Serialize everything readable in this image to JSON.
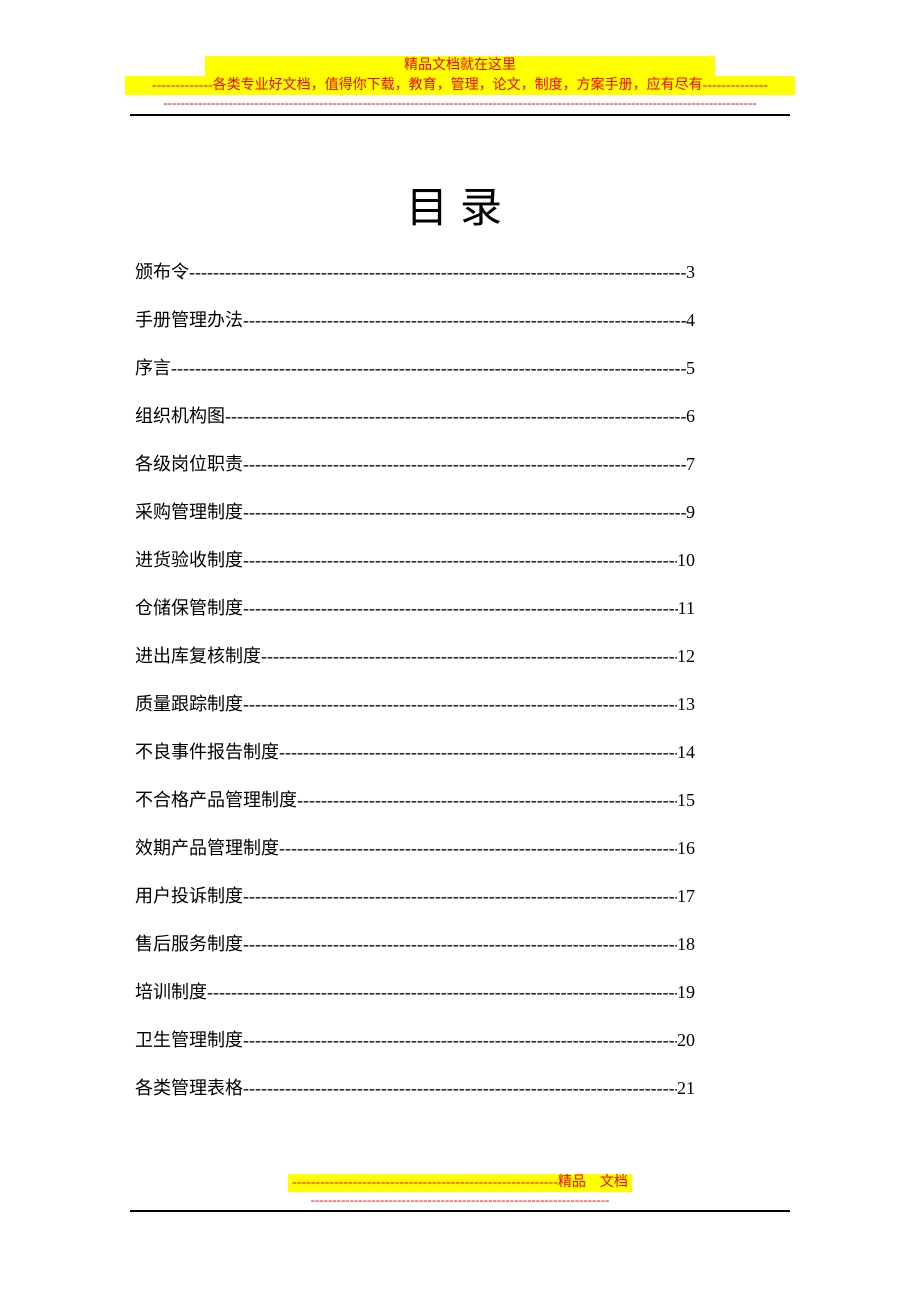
{
  "header": {
    "line1": "精品文档就在这里",
    "line2_prefix": "-------------",
    "line2_text": "各类专业好文档，值得你下载，教育，管理，论文，制度，方案手册，应有尽有",
    "line2_suffix": "--------------",
    "red_dashes": "-----------------------------------------------------------------------------------------------------------------------------------------"
  },
  "main": {
    "title": "目录",
    "toc": [
      {
        "title": "颁布令",
        "page": "3"
      },
      {
        "title": "手册管理办法",
        "page": "4"
      },
      {
        "title": "序言",
        "page": "5"
      },
      {
        "title": "组织机构图",
        "page": "6"
      },
      {
        "title": "各级岗位职责",
        "page": "7"
      },
      {
        "title": "采购管理制度",
        "page": "9"
      },
      {
        "title": "进货验收制度",
        "page": "10"
      },
      {
        "title": "仓储保管制度",
        "page": "11"
      },
      {
        "title": "进出库复核制度",
        "page": "12"
      },
      {
        "title": "质量跟踪制度",
        "page": "13"
      },
      {
        "title": "不良事件报告制度",
        "page": "14"
      },
      {
        "title": "不合格产品管理制度",
        "page": "15"
      },
      {
        "title": "效期产品管理制度",
        "page": "16"
      },
      {
        "title": "用户投诉制度",
        "page": "17"
      },
      {
        "title": "售后服务制度",
        "page": "18"
      },
      {
        "title": "培训制度",
        "page": "19"
      },
      {
        "title": "卫生管理制度",
        "page": "20"
      },
      {
        "title": "各类管理表格",
        "page": "21"
      }
    ]
  },
  "footer": {
    "dashes_left": "---------------------------------------------------------",
    "label1": "精品",
    "label2": "文档",
    "red_dashes": "---------------------------------------------------------------------"
  }
}
